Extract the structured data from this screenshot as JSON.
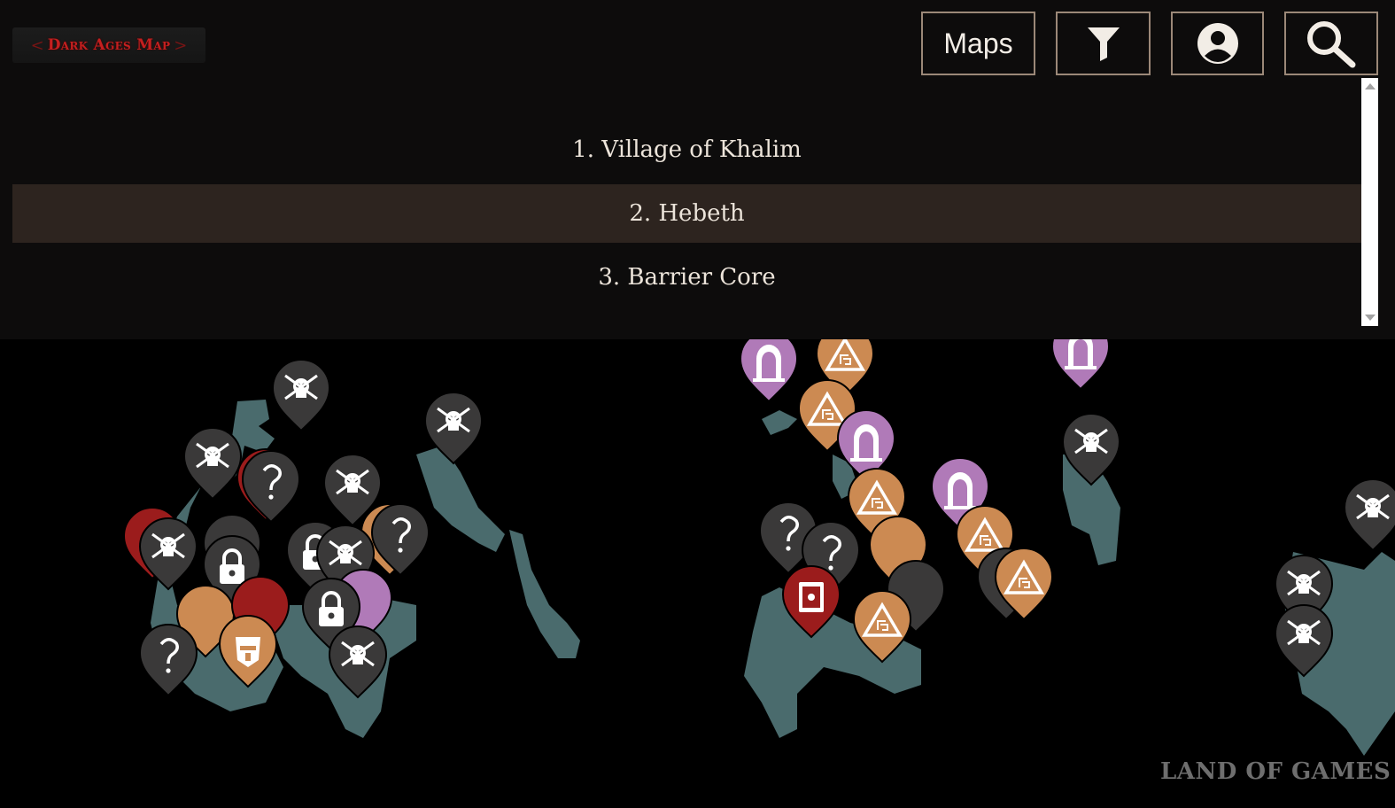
{
  "header": {
    "logo_text": "Dark Ages Map",
    "maps_button_label": "Maps",
    "filter_icon": "filter-icon",
    "account_icon": "user-account-icon",
    "search_icon": "search-icon"
  },
  "maps_dropdown": {
    "items": [
      {
        "label": "1. Village of Khalim",
        "selected": false
      },
      {
        "label": "2. Hebeth",
        "selected": true
      },
      {
        "label": "3. Barrier Core",
        "selected": false
      }
    ]
  },
  "map": {
    "marker_colors": {
      "enemy": "#3a3939",
      "secret": "#3a3939",
      "locked": "#3a3939",
      "treasure": "#cc8a52",
      "shrine": "#b07ab8",
      "danger": "#9b1c1c"
    },
    "marker_icons": [
      "skull-crossed-swords-icon",
      "question-mark-icon",
      "padlock-icon",
      "warning-triangle-icon",
      "arch-door-icon",
      "codex-icon",
      "helmet-icon"
    ],
    "terrain_color": "#4a6b6d"
  },
  "watermark": "LAND OF GAMES"
}
